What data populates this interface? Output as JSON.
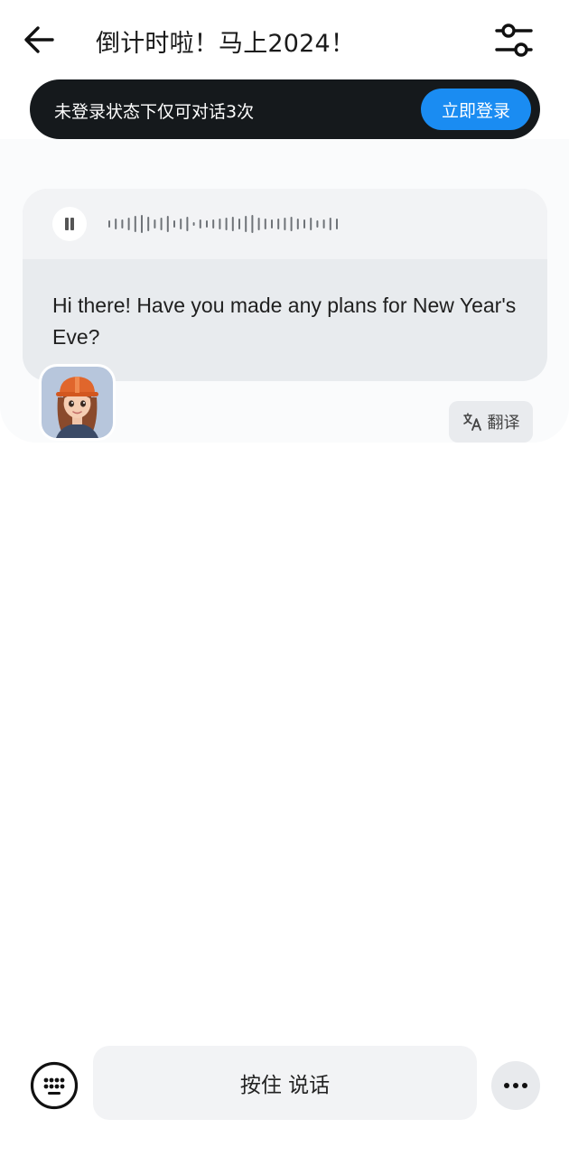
{
  "header": {
    "title": "倒计时啦！马上2024！",
    "back_icon": "arrow-left-icon",
    "settings_icon": "sliders-icon"
  },
  "banner": {
    "text": "未登录状态下仅可对话3次",
    "login_label": "立即登录",
    "accent": "#1a8cf2"
  },
  "message": {
    "text": "Hi there! Have you made any plans for New Year's Eve?",
    "audio_state": "paused",
    "translate_label": "翻译"
  },
  "input": {
    "talk_label": "按住 说话",
    "keyboard_icon": "keyboard-icon",
    "more_icon": "more-icon"
  }
}
